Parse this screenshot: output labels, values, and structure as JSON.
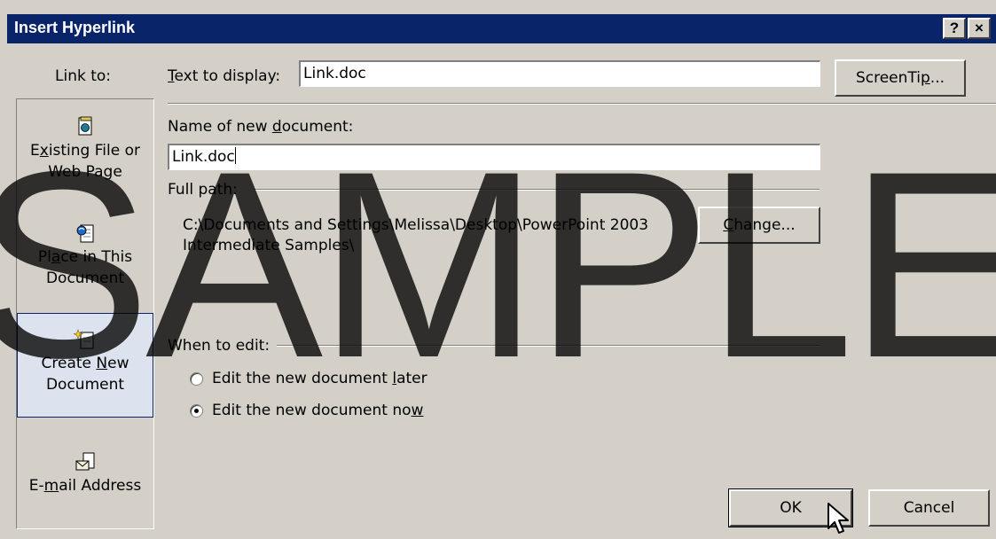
{
  "title": "Insert Hyperlink",
  "titlebar_buttons": {
    "help": "?",
    "close": "×"
  },
  "sidebar": {
    "header": "Link to:",
    "items": [
      {
        "line1_pre": "E",
        "line1_key": "x",
        "line1_post": "isting File or",
        "line2": "Web Page",
        "icon": "existing-file-icon"
      },
      {
        "line1_pre": "Pl",
        "line1_key": "a",
        "line1_post": "ce in This",
        "line2": "Document",
        "icon": "place-in-document-icon"
      },
      {
        "line1_pre": "Create ",
        "line1_key": "N",
        "line1_post": "ew",
        "line2": "Document",
        "icon": "create-new-document-icon",
        "selected": true
      },
      {
        "line1_pre": "E-",
        "line1_key": "m",
        "line1_post": "ail Address",
        "line2": "",
        "icon": "email-address-icon"
      }
    ]
  },
  "text_to_display": {
    "key": "T",
    "label_rest": "ext to display:",
    "value": "Link.doc"
  },
  "screentip": {
    "pre": "ScreenTi",
    "key": "p",
    "post": "..."
  },
  "new_doc_name": {
    "pre": "Name of new ",
    "key": "d",
    "post": "ocument:",
    "value": "Link.doc"
  },
  "full_path": {
    "label": "Full path:",
    "line1": "C:\\Documents and Settings\\Melissa\\Desktop\\PowerPoint 2003",
    "line2": "Intermediate Samples\\"
  },
  "change_button": {
    "key": "C",
    "post": "hange..."
  },
  "when_to_edit": {
    "label": "When to edit:",
    "later": {
      "pre": "Edit the new document ",
      "key": "l",
      "post": "ater",
      "checked": false
    },
    "now": {
      "pre": "Edit the new document no",
      "key": "w",
      "post": "",
      "checked": true
    }
  },
  "ok_label": "OK",
  "cancel_label": "Cancel",
  "watermark": "SAMPLE"
}
